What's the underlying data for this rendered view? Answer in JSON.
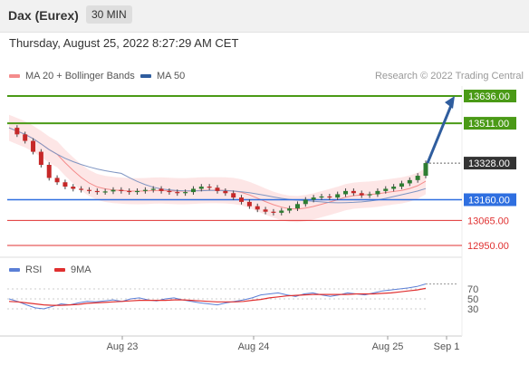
{
  "header": {
    "title": "Dax (Eurex)",
    "timeframe": "30 MIN"
  },
  "timestamp": "Thursday, August 25, 2022 8:27:29 AM CET",
  "legend": {
    "ma20": {
      "label": "MA 20 + Bollinger Bands",
      "color": "#f48c8c"
    },
    "ma50": {
      "label": "MA 50",
      "color": "#2f5d9e"
    }
  },
  "copyright": "Research © 2022 Trading Central",
  "rsi_legend": {
    "rsi": {
      "label": "RSI",
      "color": "#5b7fd6"
    },
    "ma9": {
      "label": "9MA",
      "color": "#e03030"
    }
  },
  "chart_data": [
    {
      "type": "line",
      "levels": [
        {
          "value": 13636.0,
          "label": "13636.00",
          "kind": "resistance",
          "color": "#4a9a16"
        },
        {
          "value": 13511.0,
          "label": "13511.00",
          "kind": "resistance",
          "color": "#4a9a16"
        },
        {
          "value": 13328.0,
          "label": "13328.00",
          "kind": "last-price",
          "color": "#333333"
        },
        {
          "value": 13160.0,
          "label": "13160.00",
          "kind": "pivot",
          "color": "#2f6fe0"
        },
        {
          "value": 13065.0,
          "label": "13065.00",
          "kind": "support",
          "color": "#e03030"
        },
        {
          "value": 12950.0,
          "label": "12950.00",
          "kind": "support",
          "color": "#e03030"
        }
      ],
      "x_ticks": [
        "Aug 23",
        "Aug 24",
        "Aug 25",
        "Sep 1"
      ],
      "price_path": [
        13490,
        13460,
        13430,
        13380,
        13320,
        13260,
        13240,
        13220,
        13210,
        13205,
        13200,
        13195,
        13198,
        13205,
        13200,
        13195,
        13200,
        13205,
        13210,
        13200,
        13195,
        13190,
        13195,
        13210,
        13220,
        13215,
        13200,
        13190,
        13170,
        13150,
        13130,
        13115,
        13105,
        13100,
        13110,
        13120,
        13140,
        13160,
        13170,
        13175,
        13170,
        13185,
        13200,
        13190,
        13180,
        13185,
        13200,
        13210,
        13220,
        13235,
        13250,
        13270,
        13328
      ],
      "forecast": {
        "from": 13328.0,
        "to": 13636.0
      }
    },
    {
      "type": "line",
      "name": "RSI",
      "y_ticks": [
        30,
        50,
        70
      ],
      "rsi": [
        50,
        45,
        38,
        32,
        30,
        35,
        40,
        38,
        42,
        45,
        44,
        46,
        48,
        45,
        50,
        52,
        48,
        46,
        50,
        52,
        48,
        45,
        42,
        40,
        38,
        42,
        45,
        48,
        52,
        58,
        60,
        62,
        58,
        55,
        60,
        62,
        58,
        55,
        58,
        62,
        60,
        58,
        62,
        66,
        68,
        70,
        72,
        75,
        80
      ],
      "ma9": [
        45,
        44,
        42,
        40,
        38,
        37,
        37,
        38,
        39,
        41,
        42,
        43,
        44,
        45,
        46,
        47,
        47,
        47,
        47,
        48,
        48,
        47,
        46,
        45,
        44,
        44,
        44,
        45,
        47,
        49,
        52,
        54,
        56,
        57,
        58,
        59,
        59,
        59,
        59,
        59,
        60,
        60,
        60,
        61,
        62,
        64,
        66,
        68,
        71
      ]
    }
  ]
}
